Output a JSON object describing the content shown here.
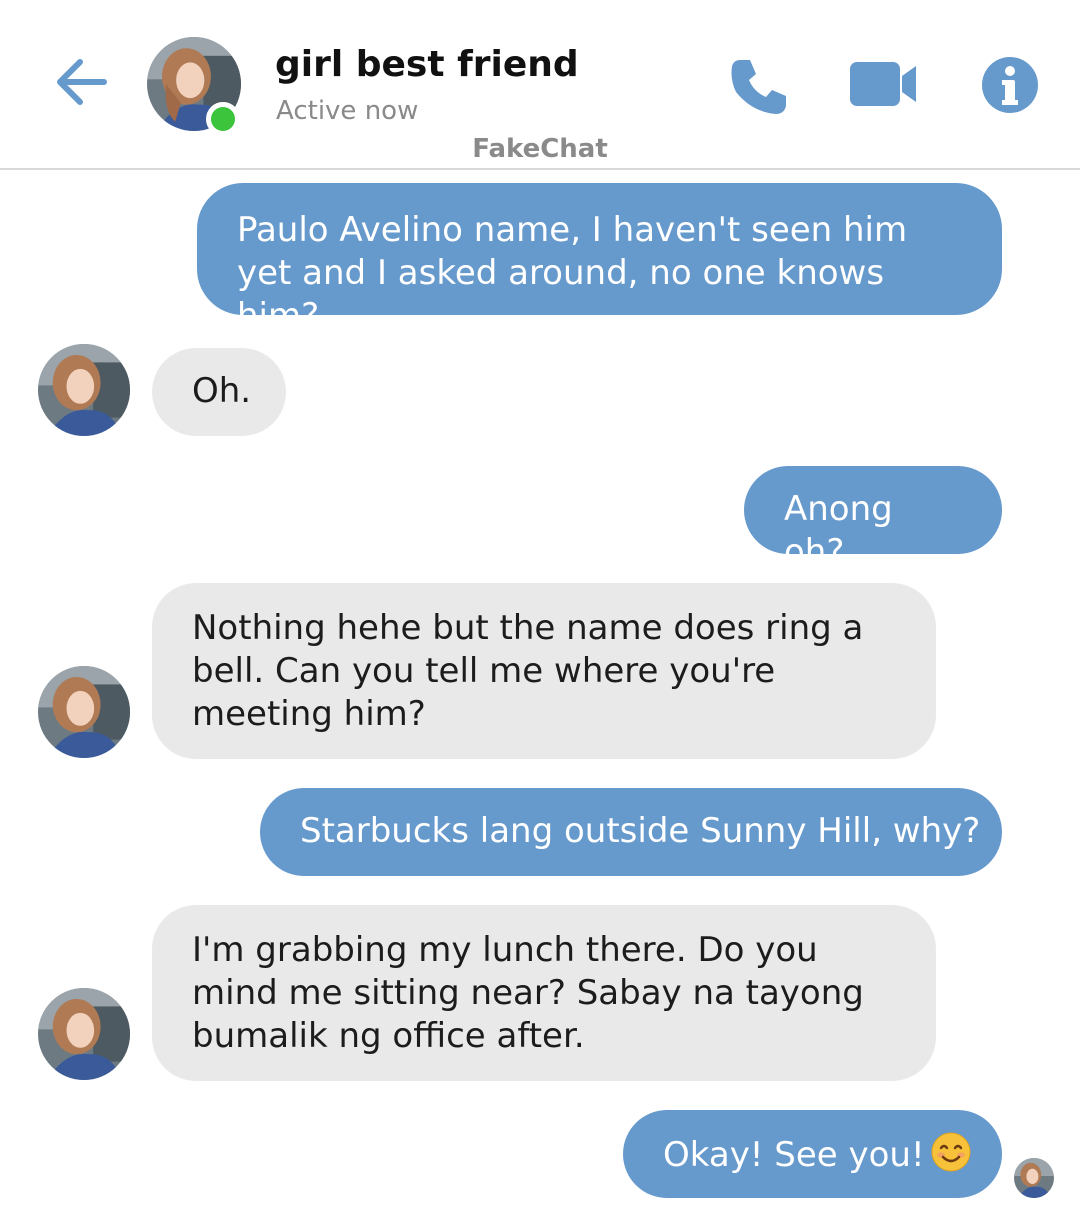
{
  "header": {
    "contact_name": "girl best friend",
    "status": "Active now",
    "watermark": "FakeChat",
    "accent_color": "#6699cc",
    "online_color": "#3cc43c",
    "icons": [
      "back-arrow-icon",
      "phone-icon",
      "video-camera-icon",
      "info-icon"
    ]
  },
  "messages": [
    {
      "from": "me",
      "text": "Paulo Avelino name, I haven't seen him yet and I asked around, no one knows him?"
    },
    {
      "from": "friend",
      "text": "Oh."
    },
    {
      "from": "me",
      "text": "Anong oh?"
    },
    {
      "from": "friend",
      "text": "Nothing hehe but the name does ring a bell. Can you tell me where you're meeting him?"
    },
    {
      "from": "me",
      "text": "Starbucks lang outside Sunny Hill, why?"
    },
    {
      "from": "friend",
      "text": "I'm grabbing my lunch there. Do you mind me sitting near? Sabay na tayong bumalik ng office after."
    },
    {
      "from": "me",
      "text": "Okay! See you!",
      "emoji": "smiling-face-emoji"
    }
  ],
  "bubble_colors": {
    "sent": "#6699cc",
    "received": "#e9e9e9"
  }
}
